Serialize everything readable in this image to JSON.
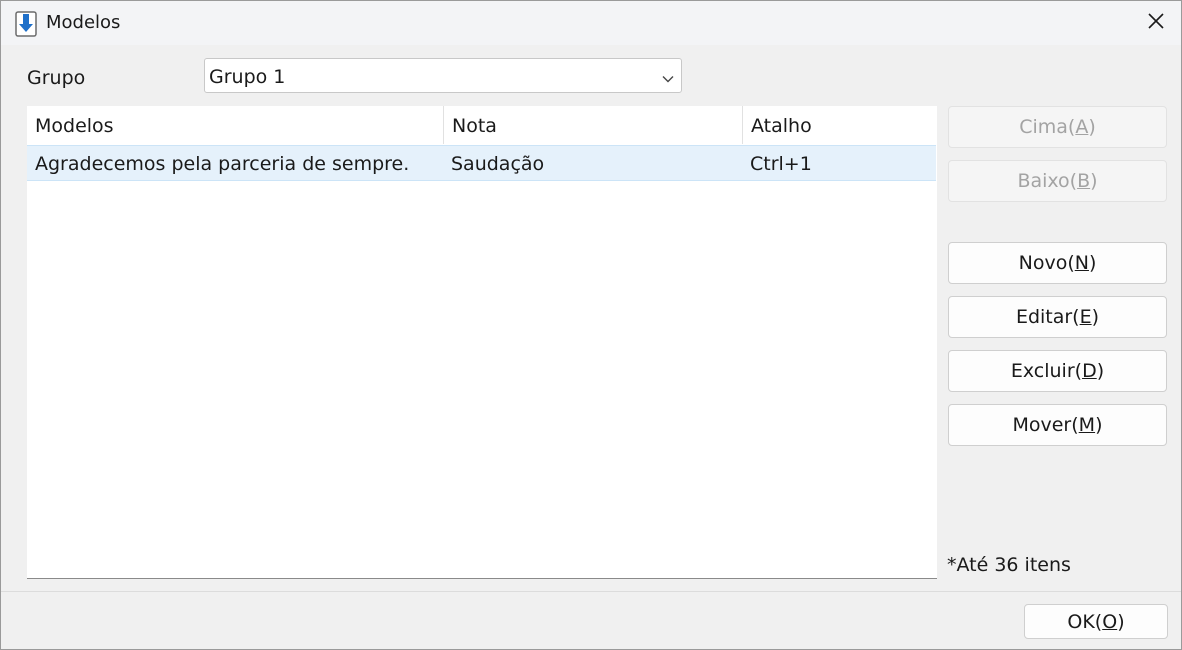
{
  "window": {
    "title": "Modelos",
    "close_symbol": "✕"
  },
  "group": {
    "label": "Grupo",
    "selected": "Grupo 1"
  },
  "list": {
    "columns": [
      "Modelos",
      "Nota",
      "Atalho"
    ],
    "rows": [
      {
        "modelo": "Agradecemos pela parceria de sempre.",
        "nota": "Saudação",
        "atalho": "Ctrl+1"
      }
    ]
  },
  "buttons": {
    "up": {
      "text": "Cima(",
      "key": "A",
      "close": ")"
    },
    "down": {
      "text": "Baixo(",
      "key": "B",
      "close": ")"
    },
    "new": {
      "text": "Novo(",
      "key": "N",
      "close": ")"
    },
    "edit": {
      "text": "Editar(",
      "key": "E",
      "close": ")"
    },
    "delete": {
      "text": "Excluir(",
      "key": "D",
      "close": ")"
    },
    "move": {
      "text": "Mover(",
      "key": "M",
      "close": ")"
    },
    "ok": {
      "text": "OK(",
      "key": "O",
      "close": ")"
    }
  },
  "note": "*Até 36 itens",
  "icons": {
    "app": "download-arrow-icon",
    "close": "close-icon",
    "dropdown": "chevron-down-icon"
  },
  "colors": {
    "accent": "#1e6fc9",
    "selection": "#e5f1fb",
    "disabled_text": "#a3a3a3"
  }
}
